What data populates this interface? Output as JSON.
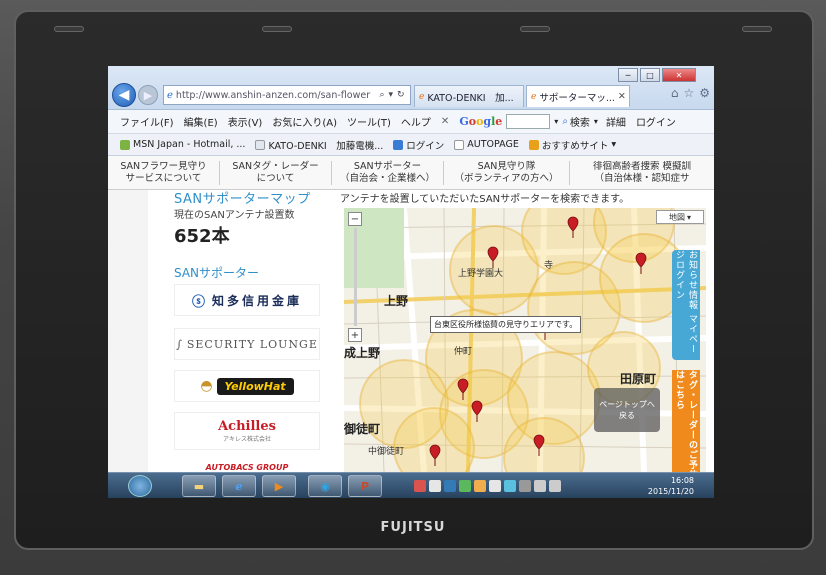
{
  "laptop": {
    "brand": "FUJITSU"
  },
  "browser": {
    "address": "http://www.anshin-anzen.com/san-flower",
    "tabs": [
      {
        "label": "KATO-DENKI　加..."
      },
      {
        "label": "サポーターマッ..."
      }
    ],
    "window_controls": {
      "min": "─",
      "max": "□",
      "close": "✕"
    }
  },
  "menu": {
    "items": [
      "ファイル(F)",
      "編集(E)",
      "表示(V)",
      "お気に入り(A)",
      "ツール(T)",
      "ヘルプ"
    ],
    "google": {
      "g": "G",
      "o1": "o",
      "o2": "o",
      "g2": "g",
      "l": "l",
      "e": "e"
    },
    "search_label": "検索",
    "detail_label": "詳細",
    "login_label": "ログイン"
  },
  "favorites": {
    "items": [
      "MSN Japan - Hotmail, ...",
      "KATO-DENKI　加藤電機...",
      "ログイン",
      "AUTOPAGE",
      "おすすめサイト"
    ]
  },
  "site_nav": {
    "items": [
      {
        "line1": "SANフラワー見守り",
        "line2": "サービスについて"
      },
      {
        "line1": "SANタグ・レーダー",
        "line2": "について"
      },
      {
        "line1": "SANサポーター",
        "line2": "（自治会・企業様へ）"
      },
      {
        "line1": "SAN見守り隊",
        "line2": "（ボランティアの方へ）"
      },
      {
        "line1": "徘徊高齢者捜索 模擬訓",
        "line2": "（自治体様・認知症サ"
      }
    ]
  },
  "sidebar": {
    "map_title": "SANサポーターマップ",
    "count_label": "現在のSANアンテナ設置数",
    "count": "652本",
    "supporter_title": "SANサポーター",
    "sponsors": {
      "s1": "知多信用金庫",
      "s2": "SECURITY LOUNGE",
      "s3": "YellowHat",
      "s4": "Achilles",
      "s4_sub": "アキレス株式会社",
      "s5": "AUTOBACS GROUP"
    }
  },
  "map": {
    "description": "アンテナを設置していただいたSANサポーターを検索できます。",
    "type_button": "地図",
    "tooltip": "台東区役所様協賛の見守りエリアです。",
    "labels": {
      "ueno_gakuen": "上野学園大",
      "ueno": "上野",
      "seijo_ueno": "成上野",
      "asakusa": "浅草",
      "tawaramachi": "田原町",
      "okachimachi": "御徒町",
      "nakaokachimachi": "中御徒町",
      "nakacho": "仲町",
      "koshin": "寺"
    },
    "back_to_top": "ページトップへ\n戻る",
    "side_tab_1": "お知らせ情報 マイページログイン",
    "side_tab_2": "タグ・レーダーのご予約はこちら"
  },
  "taskbar": {
    "time": "16:08",
    "date": "2015/11/20",
    "apps": {
      "pp": "P"
    }
  }
}
